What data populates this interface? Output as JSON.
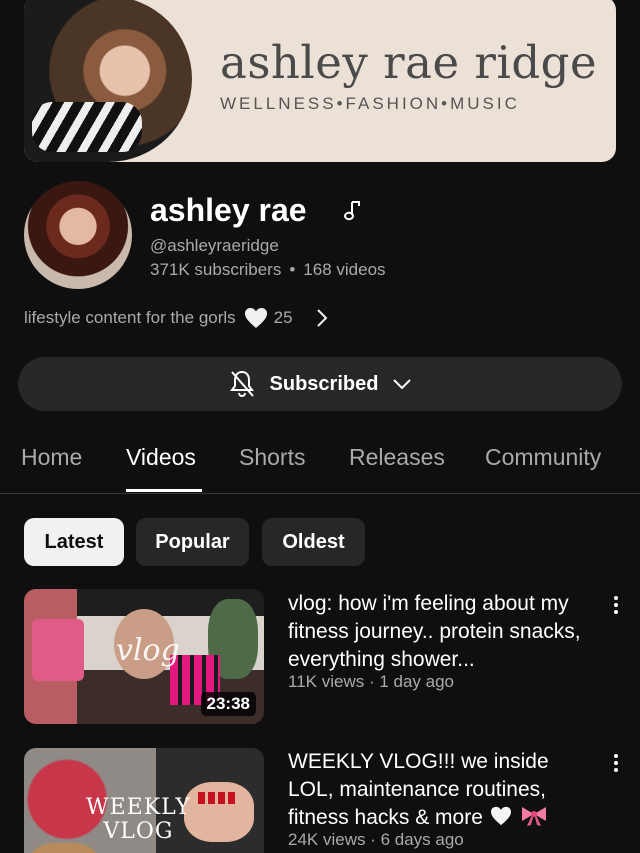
{
  "banner": {
    "title": "ashley rae ridge",
    "subtitle": "WELLNESS•FASHION•MUSIC"
  },
  "channel": {
    "name": "ashley rae",
    "name_icon": "music-note-icon",
    "handle": "@ashleyraeridge",
    "subscribers": "371K subscribers",
    "separator": "•",
    "videos": "168 videos",
    "description": "lifestyle content for the gorls",
    "description_icon": "white-heart-icon",
    "link_count": "25"
  },
  "subscribe": {
    "label": "Subscribed",
    "icon": "bell-slash-icon"
  },
  "tabs": [
    {
      "label": "Home"
    },
    {
      "label": "Videos"
    },
    {
      "label": "Shorts"
    },
    {
      "label": "Releases"
    },
    {
      "label": "Community"
    }
  ],
  "active_tab": "Videos",
  "chips": [
    {
      "label": "Latest"
    },
    {
      "label": "Popular"
    },
    {
      "label": "Oldest"
    }
  ],
  "active_chip": "Latest",
  "videos": [
    {
      "title": "vlog: how i'm feeling about my fitness journey.. protein snacks, everything shower...",
      "meta": "11K views · 1 day ago",
      "duration": "23:38",
      "thumb_text": "vlog"
    },
    {
      "title": "WEEKLY VLOG!!! we inside LOL, maintenance routines, fitness hacks & more",
      "meta": "24K views · 6 days ago",
      "thumb_text": "WEEKLY\nVLOG"
    }
  ],
  "colors": {
    "background": "#0f0f0f",
    "banner_bg": "#ebe1d7",
    "button_bg": "#272727",
    "secondary_text": "#aaaaaa"
  }
}
